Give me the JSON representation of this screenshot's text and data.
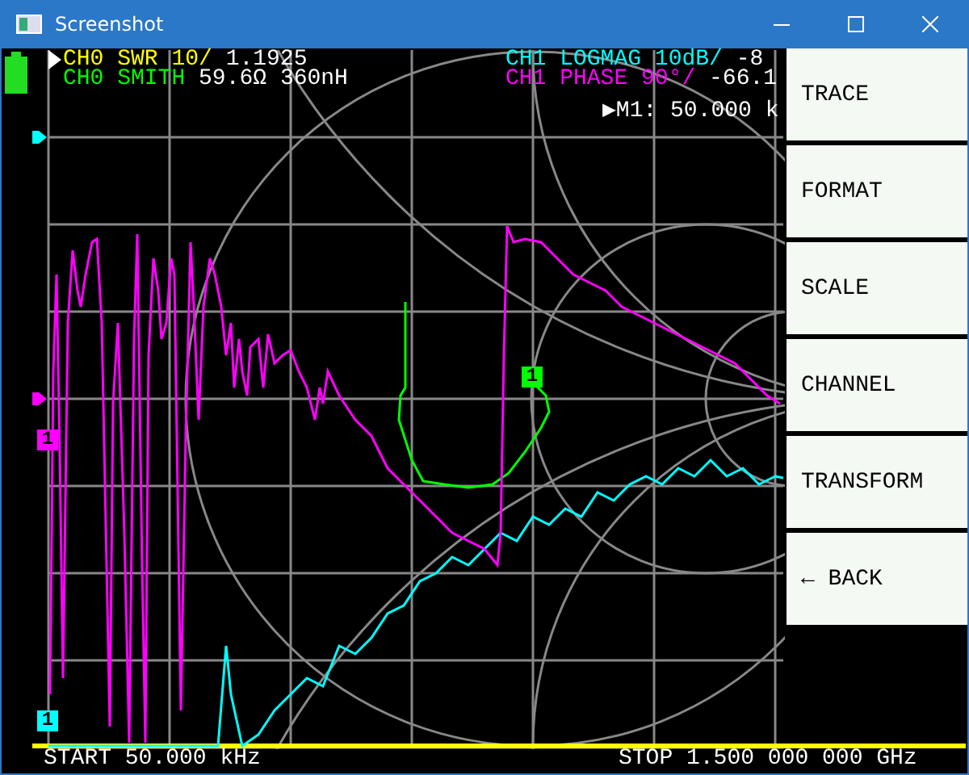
{
  "window": {
    "title": "Screenshot"
  },
  "traces": [
    {
      "label": "CH0 SWR 10/",
      "value": "1.1925",
      "color": "#ffff00",
      "selected": true
    },
    {
      "label": "CH0 SMITH",
      "value": "59.6Ω 360nH",
      "color": "#00ff00",
      "selected": false,
      "marker": "1"
    },
    {
      "label": "CH1 LOGMAG 10dB/",
      "value": "-8",
      "color": "#00ffff",
      "selected": false,
      "marker": "1"
    },
    {
      "label": "CH1 PHASE 90°/",
      "value": "-66.1",
      "color": "#ff00ff",
      "selected": false,
      "marker": "1"
    }
  ],
  "marker_readout": "▶M1: 50.000 k",
  "start": "START 50.000 kHz",
  "stop": "STOP 1.500 000 000 GHz",
  "menu": [
    "TRACE",
    "FORMAT",
    "SCALE",
    "CHANNEL",
    "TRANSFORM",
    "← BACK"
  ]
}
